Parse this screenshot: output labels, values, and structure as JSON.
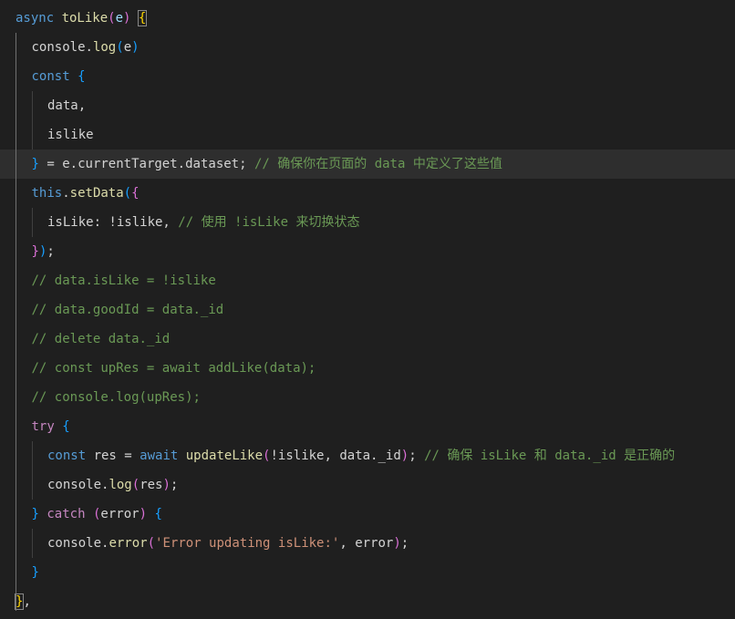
{
  "editor": {
    "lines": [
      {
        "indent": 0,
        "highlight": false,
        "tokens": [
          {
            "t": "async ",
            "c": "kb"
          },
          {
            "t": "toLike",
            "c": "fn"
          },
          {
            "t": "(",
            "c": "br2"
          },
          {
            "t": "e",
            "c": "prop"
          },
          {
            "t": ")",
            "c": "br2"
          },
          {
            "t": " ",
            "c": "id"
          },
          {
            "t": "{",
            "c": "br1",
            "box": true
          }
        ]
      },
      {
        "indent": 1,
        "highlight": false,
        "tokens": [
          {
            "t": "console",
            "c": "id"
          },
          {
            "t": ".",
            "c": "id"
          },
          {
            "t": "log",
            "c": "fn"
          },
          {
            "t": "(",
            "c": "br3"
          },
          {
            "t": "e",
            "c": "id"
          },
          {
            "t": ")",
            "c": "br3"
          }
        ]
      },
      {
        "indent": 1,
        "highlight": false,
        "tokens": [
          {
            "t": "const ",
            "c": "kb"
          },
          {
            "t": "{",
            "c": "br3"
          }
        ]
      },
      {
        "indent": 2,
        "highlight": false,
        "tokens": [
          {
            "t": "data",
            "c": "id"
          },
          {
            "t": ",",
            "c": "id"
          }
        ]
      },
      {
        "indent": 2,
        "highlight": false,
        "tokens": [
          {
            "t": "islike",
            "c": "id"
          }
        ]
      },
      {
        "indent": 1,
        "highlight": true,
        "tokens": [
          {
            "t": "}",
            "c": "br3"
          },
          {
            "t": " = e",
            "c": "id"
          },
          {
            "t": ".",
            "c": "id"
          },
          {
            "t": "currentTarget",
            "c": "id"
          },
          {
            "t": ".",
            "c": "id"
          },
          {
            "t": "dataset",
            "c": "id"
          },
          {
            "t": "; ",
            "c": "id"
          },
          {
            "t": "// 确保你在页面的 data 中定义了这些值",
            "c": "cmt"
          }
        ]
      },
      {
        "indent": 1,
        "highlight": false,
        "tokens": [
          {
            "t": "this",
            "c": "kb"
          },
          {
            "t": ".",
            "c": "id"
          },
          {
            "t": "setData",
            "c": "fn"
          },
          {
            "t": "(",
            "c": "br3"
          },
          {
            "t": "{",
            "c": "br2"
          }
        ]
      },
      {
        "indent": 2,
        "highlight": false,
        "tokens": [
          {
            "t": "isLike",
            "c": "id"
          },
          {
            "t": ": !islike, ",
            "c": "id"
          },
          {
            "t": "// 使用 !isLike 来切换状态",
            "c": "cmt"
          }
        ]
      },
      {
        "indent": 1,
        "highlight": false,
        "tokens": [
          {
            "t": "}",
            "c": "br2"
          },
          {
            "t": ")",
            "c": "br3"
          },
          {
            "t": ";",
            "c": "id"
          }
        ]
      },
      {
        "indent": 1,
        "highlight": false,
        "tokens": [
          {
            "t": "// data.isLike = !islike",
            "c": "cmt"
          }
        ]
      },
      {
        "indent": 1,
        "highlight": false,
        "tokens": [
          {
            "t": "// data.goodId = data._id",
            "c": "cmt"
          }
        ]
      },
      {
        "indent": 1,
        "highlight": false,
        "tokens": [
          {
            "t": "// delete data._id",
            "c": "cmt"
          }
        ]
      },
      {
        "indent": 1,
        "highlight": false,
        "tokens": [
          {
            "t": "// const upRes = await addLike(data);",
            "c": "cmt"
          }
        ]
      },
      {
        "indent": 1,
        "highlight": false,
        "tokens": [
          {
            "t": "// console.log(upRes);",
            "c": "cmt"
          }
        ]
      },
      {
        "indent": 1,
        "highlight": false,
        "tokens": [
          {
            "t": "try",
            "c": "kw"
          },
          {
            "t": " ",
            "c": "id"
          },
          {
            "t": "{",
            "c": "br3"
          }
        ]
      },
      {
        "indent": 2,
        "highlight": false,
        "tokens": [
          {
            "t": "const ",
            "c": "kb"
          },
          {
            "t": "res",
            "c": "id"
          },
          {
            "t": " = ",
            "c": "id"
          },
          {
            "t": "await ",
            "c": "kb"
          },
          {
            "t": "updateLike",
            "c": "fn"
          },
          {
            "t": "(",
            "c": "br2"
          },
          {
            "t": "!islike, data._id",
            "c": "id"
          },
          {
            "t": ")",
            "c": "br2"
          },
          {
            "t": "; ",
            "c": "id"
          },
          {
            "t": "// 确保 isLike 和 data._id 是正确的",
            "c": "cmt"
          }
        ]
      },
      {
        "indent": 2,
        "highlight": false,
        "tokens": [
          {
            "t": "console",
            "c": "id"
          },
          {
            "t": ".",
            "c": "id"
          },
          {
            "t": "log",
            "c": "fn"
          },
          {
            "t": "(",
            "c": "br2"
          },
          {
            "t": "res",
            "c": "id"
          },
          {
            "t": ")",
            "c": "br2"
          },
          {
            "t": ";",
            "c": "id"
          }
        ]
      },
      {
        "indent": 1,
        "highlight": false,
        "tokens": [
          {
            "t": "}",
            "c": "br3"
          },
          {
            "t": " ",
            "c": "id"
          },
          {
            "t": "catch",
            "c": "kw"
          },
          {
            "t": " ",
            "c": "id"
          },
          {
            "t": "(",
            "c": "br2"
          },
          {
            "t": "error",
            "c": "id"
          },
          {
            "t": ")",
            "c": "br2"
          },
          {
            "t": " ",
            "c": "id"
          },
          {
            "t": "{",
            "c": "br3"
          }
        ]
      },
      {
        "indent": 2,
        "highlight": false,
        "tokens": [
          {
            "t": "console",
            "c": "id"
          },
          {
            "t": ".",
            "c": "id"
          },
          {
            "t": "error",
            "c": "fn"
          },
          {
            "t": "(",
            "c": "br2"
          },
          {
            "t": "'Error updating isLike:'",
            "c": "str"
          },
          {
            "t": ", error",
            "c": "id"
          },
          {
            "t": ")",
            "c": "br2"
          },
          {
            "t": ";",
            "c": "id"
          }
        ]
      },
      {
        "indent": 1,
        "highlight": false,
        "tokens": [
          {
            "t": "}",
            "c": "br3"
          }
        ]
      },
      {
        "indent": 0,
        "highlight": false,
        "tokens": [
          {
            "t": "}",
            "c": "br1",
            "box": true
          },
          {
            "t": ",",
            "c": "id"
          }
        ]
      }
    ]
  }
}
